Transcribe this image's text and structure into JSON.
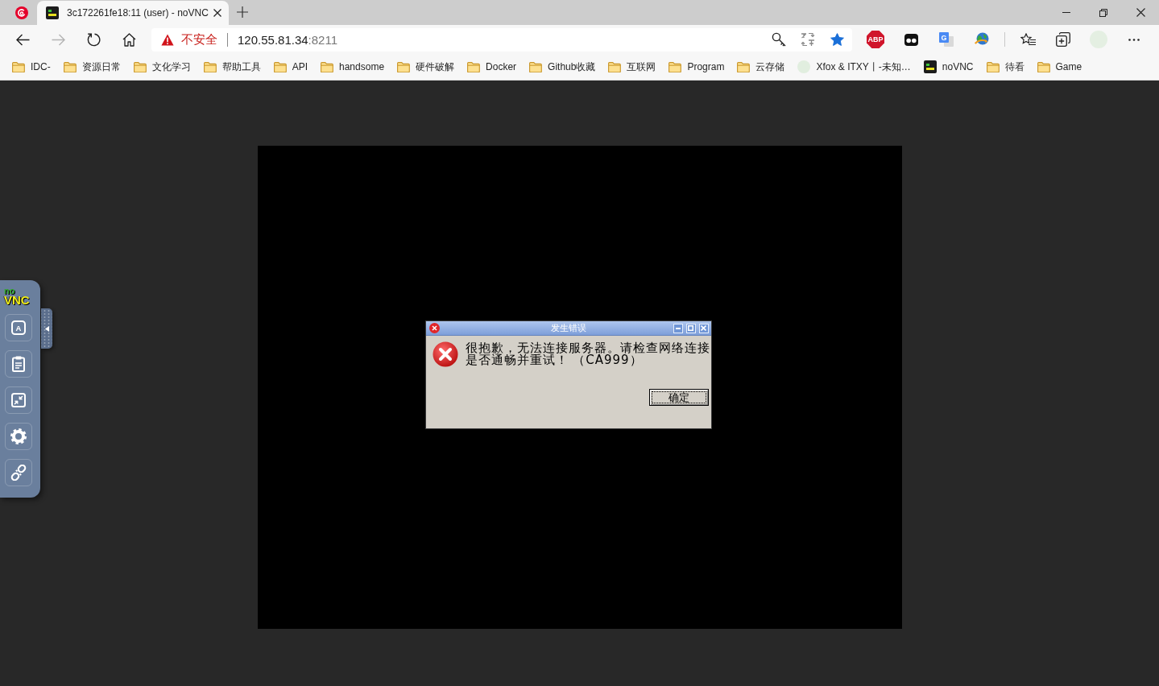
{
  "browser": {
    "tabs": [
      {
        "kind": "pinned",
        "selected": false
      },
      {
        "kind": "page",
        "title": "3c172261fe18:11 (user) - noVNC",
        "selected": true
      }
    ],
    "nav_buttons": [
      {
        "kind": "back",
        "disabled": false
      },
      {
        "kind": "forward",
        "disabled": true
      },
      {
        "kind": "reload",
        "disabled": false
      },
      {
        "kind": "home",
        "disabled": false
      }
    ],
    "address_bar": {
      "security_label": "不安全",
      "host": "120.55.81.34",
      "port": ":8211",
      "bookmarked": true
    },
    "extensions": [
      {
        "kind": "adblock",
        "glyph": "ABP"
      },
      {
        "kind": "eyes"
      },
      {
        "kind": "translate",
        "glyph": "G"
      },
      {
        "kind": "globe"
      }
    ],
    "bookmarks": [
      {
        "kind": "folder",
        "label": "IDC-"
      },
      {
        "kind": "folder",
        "label": "资源日常"
      },
      {
        "kind": "folder",
        "label": "文化学习"
      },
      {
        "kind": "folder",
        "label": "帮助工具"
      },
      {
        "kind": "folder",
        "label": "API"
      },
      {
        "kind": "folder",
        "label": "handsome"
      },
      {
        "kind": "folder",
        "label": "硬件破解"
      },
      {
        "kind": "folder",
        "label": "Docker"
      },
      {
        "kind": "folder",
        "label": "Github收藏"
      },
      {
        "kind": "folder",
        "label": "互联网"
      },
      {
        "kind": "folder",
        "label": "Program"
      },
      {
        "kind": "folder",
        "label": "云存储"
      },
      {
        "kind": "avatar",
        "label": "Xfox & ITXY丨-未知…"
      },
      {
        "kind": "vnc",
        "label": "noVNC"
      },
      {
        "kind": "folder",
        "label": "待看"
      },
      {
        "kind": "folder",
        "label": "Game"
      }
    ]
  },
  "novnc": {
    "logo": {
      "top": "no",
      "bottom": "VNC"
    },
    "controls": [
      {
        "kind": "keyboard",
        "glyph": "A"
      },
      {
        "kind": "clipboard"
      },
      {
        "kind": "fullscreen"
      },
      {
        "kind": "settings"
      },
      {
        "kind": "disconnect"
      }
    ],
    "dialog": {
      "title": "发生错误",
      "message": "很抱歉，无法连接服务器。请检查网络连接是否通畅并重试！ （CA999）",
      "ok_label": "确定"
    }
  }
}
